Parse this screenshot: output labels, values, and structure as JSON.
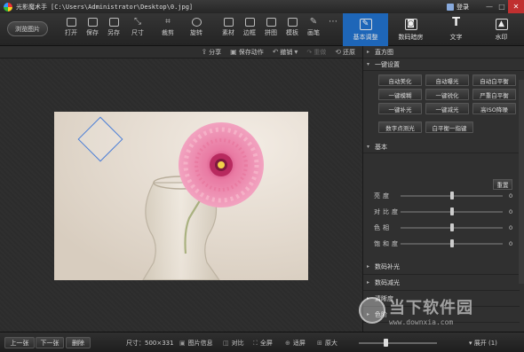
{
  "window": {
    "app_title": "光影魔术手",
    "path": "[C:\\Users\\Administrator\\Desktop\\0.jpg]",
    "login_label": "登录",
    "min": "—",
    "max": "□",
    "close": "✕"
  },
  "toolbar": {
    "browse_label": "浏览图片",
    "tools": [
      {
        "label": "打开",
        "icon": "open-icon"
      },
      {
        "label": "保存",
        "icon": "save-icon"
      },
      {
        "label": "另存",
        "icon": "save-as-icon"
      },
      {
        "label": "尺寸",
        "icon": "resize-icon"
      },
      {
        "label": "裁剪",
        "icon": "crop-icon"
      },
      {
        "label": "旋转",
        "icon": "rotate-icon"
      },
      {
        "label": "素材",
        "icon": "material-icon"
      },
      {
        "label": "边框",
        "icon": "border-icon"
      },
      {
        "label": "拼图",
        "icon": "collage-icon"
      },
      {
        "label": "模板",
        "icon": "template-icon"
      },
      {
        "label": "画笔",
        "icon": "brush-icon"
      },
      {
        "label": "…",
        "icon": "more-icon"
      }
    ]
  },
  "right_tabs": [
    {
      "label": "基本调整",
      "glyph": "✎",
      "active": true
    },
    {
      "label": "数码暗房",
      "glyph": "◙",
      "active": false
    },
    {
      "label": "文字",
      "glyph": "T",
      "active": false
    },
    {
      "label": "水印",
      "glyph": "▲",
      "active": false
    }
  ],
  "subbar": {
    "share": "分享",
    "save_action": "保存动作",
    "undo": "撤销",
    "redo": "重做",
    "restore": "还原"
  },
  "panel": {
    "histogram": "直方图",
    "oneclick_title": "一键设置",
    "oneclick_buttons": [
      "自动美化",
      "自动曝光",
      "自动白平衡",
      "一键模糊",
      "一键锐化",
      "严重白平衡",
      "一键补光",
      "一键减光",
      "高ISO降噪"
    ],
    "extra_buttons": [
      "数字点测光",
      "白平衡一指键"
    ],
    "basic_title": "基本",
    "reset": "重置",
    "sliders": [
      {
        "label": "亮度",
        "value": 0,
        "level": 0.5
      },
      {
        "label": "对比度",
        "value": 0,
        "level": 0.5
      },
      {
        "label": "色相",
        "value": 0,
        "level": 0.5
      },
      {
        "label": "饱和度",
        "value": 0,
        "level": 0.5
      }
    ],
    "sections": [
      "数码补光",
      "数码减光",
      "清晰度",
      "色阶"
    ]
  },
  "bottom": {
    "prev": "上一张",
    "next": "下一张",
    "delete": "删除",
    "size_label": "尺寸：500×331",
    "info": "图片信息",
    "compare": "对比",
    "fullscreen": "全屏",
    "fit": "适屏",
    "original": "原大",
    "expand": "▾ 展开 (1)"
  },
  "watermark": {
    "cn": "当下软件园",
    "url": "www.downxia.com"
  }
}
